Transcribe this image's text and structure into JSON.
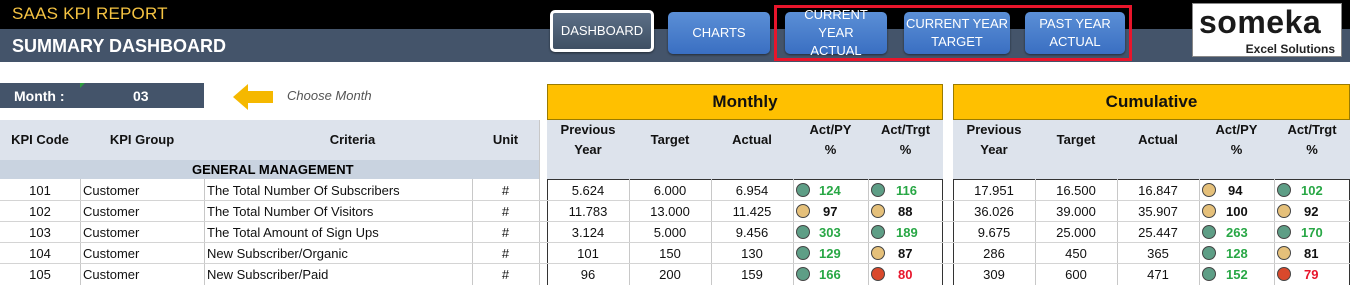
{
  "header": {
    "app_title": "SAAS KPI REPORT",
    "page_title": "SUMMARY DASHBOARD"
  },
  "nav": [
    {
      "label": "DASHBOARD",
      "active": true
    },
    {
      "label": "CHARTS",
      "active": false
    },
    {
      "label": "CURRENT YEAR\nACTUAL",
      "active": false
    },
    {
      "label": "CURRENT YEAR\nTARGET",
      "active": false
    },
    {
      "label": "PAST YEAR\nACTUAL",
      "active": false
    }
  ],
  "logo": {
    "name": "someka",
    "subtitle": "Excel Solutions"
  },
  "month": {
    "label": "Month :",
    "value": "03",
    "hint": "Choose Month"
  },
  "sections": {
    "monthly": "Monthly",
    "cumulative": "Cumulative"
  },
  "columns": {
    "kpi_code": "KPI Code",
    "kpi_group": "KPI Group",
    "criteria": "Criteria",
    "unit": "Unit",
    "previous_year": "Previous\nYear",
    "target": "Target",
    "actual": "Actual",
    "act_py": "Act/PY\n%",
    "act_trgt": "Act/Trgt\n%"
  },
  "group_name": "GENERAL MANAGEMENT",
  "colors": {
    "green": "#5e9e86",
    "yellow": "#e5c07a",
    "red": "#d9492c"
  },
  "rows": [
    {
      "code": "101",
      "group": "Customer",
      "criteria": "The Total Number Of Subscribers",
      "unit": "#",
      "m_prev": "5.624",
      "m_target": "6.000",
      "m_actual": "6.954",
      "m_py": "124",
      "m_py_s": "green",
      "m_tg": "116",
      "m_tg_s": "green",
      "c_prev": "17.951",
      "c_target": "16.500",
      "c_actual": "16.847",
      "c_py": "94",
      "c_py_s": "yellow",
      "c_tg": "102",
      "c_tg_s": "green"
    },
    {
      "code": "102",
      "group": "Customer",
      "criteria": "The Total Number Of Visitors",
      "unit": "#",
      "m_prev": "11.783",
      "m_target": "13.000",
      "m_actual": "11.425",
      "m_py": "97",
      "m_py_s": "yellow",
      "m_tg": "88",
      "m_tg_s": "yellow",
      "c_prev": "36.026",
      "c_target": "39.000",
      "c_actual": "35.907",
      "c_py": "100",
      "c_py_s": "yellow",
      "c_tg": "92",
      "c_tg_s": "yellow"
    },
    {
      "code": "103",
      "group": "Customer",
      "criteria": "The Total Amount of Sign Ups",
      "unit": "#",
      "m_prev": "3.124",
      "m_target": "5.000",
      "m_actual": "9.456",
      "m_py": "303",
      "m_py_s": "green",
      "m_tg": "189",
      "m_tg_s": "green",
      "c_prev": "9.675",
      "c_target": "25.000",
      "c_actual": "25.447",
      "c_py": "263",
      "c_py_s": "green",
      "c_tg": "170",
      "c_tg_s": "green"
    },
    {
      "code": "104",
      "group": "Customer",
      "criteria": "New Subscriber/Organic",
      "unit": "#",
      "m_prev": "101",
      "m_target": "150",
      "m_actual": "130",
      "m_py": "129",
      "m_py_s": "green",
      "m_tg": "87",
      "m_tg_s": "yellow",
      "c_prev": "286",
      "c_target": "450",
      "c_actual": "365",
      "c_py": "128",
      "c_py_s": "green",
      "c_tg": "81",
      "c_tg_s": "yellow"
    },
    {
      "code": "105",
      "group": "Customer",
      "criteria": "New Subscriber/Paid",
      "unit": "#",
      "m_prev": "96",
      "m_target": "200",
      "m_actual": "159",
      "m_py": "166",
      "m_py_s": "green",
      "m_tg": "80",
      "m_tg_s": "red",
      "c_prev": "309",
      "c_target": "600",
      "c_actual": "471",
      "c_py": "152",
      "c_py_s": "green",
      "c_tg": "79",
      "c_tg_s": "red"
    }
  ]
}
